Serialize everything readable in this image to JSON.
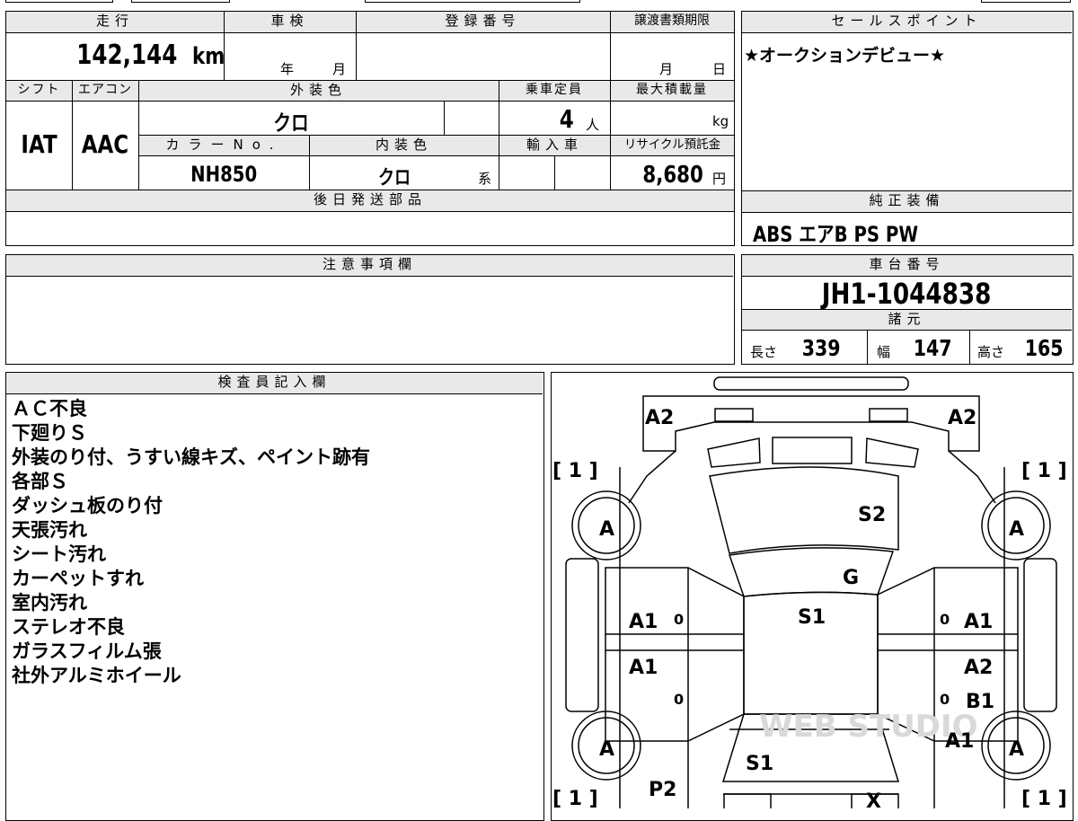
{
  "top_left": {
    "headers": {
      "mileage": "走行",
      "inspection": "車検",
      "registration": "登録番号",
      "transfer": "譲渡書類期限",
      "shift": "シフト",
      "aircon": "エアコン",
      "exterior_color": "外装色",
      "capacity": "乗車定員",
      "max_load": "最大積載量",
      "color_no": "カラーNo.",
      "interior_color": "内装色",
      "import": "輸入車",
      "recycle": "リサイクル預託金",
      "later_parts": "後日発送部品",
      "notes": "注意事項欄"
    },
    "mileage_value": "142,144",
    "mileage_unit": "km",
    "year_unit": "年",
    "month_unit": "月",
    "transfer_month": "月",
    "transfer_day": "日",
    "shift_value": "IAT",
    "aircon_value": "AAC",
    "exterior_color_value": "クロ",
    "capacity_value": "4",
    "capacity_unit": "人",
    "load_unit": "kg",
    "color_no_value": "NH850",
    "interior_color_value": "クロ",
    "interior_suffix": "系",
    "recycle_value": "8,680",
    "recycle_unit": "円"
  },
  "right_panel": {
    "sales_point_header": "セールスポイント",
    "sales_point_text": "★オークションデビュー★",
    "equipment_header": "純正装備",
    "equipment_value": "ABS エアB PS PW",
    "chassis_header": "車台番号",
    "chassis_value": "JH1-1044838",
    "specs_header": "諸元",
    "length_label": "長さ",
    "length_value": "339",
    "width_label": "幅",
    "width_value": "147",
    "height_label": "高さ",
    "height_value": "165"
  },
  "inspector": {
    "header": "検査員記入欄",
    "lines": [
      "ＡＣ不良",
      "下廻りＳ",
      "外装のり付、うすい線キズ、ペイント跡有",
      "各部Ｓ",
      "ダッシュ板のり付",
      "天張汚れ",
      "シート汚れ",
      "カーペットすれ",
      "室内汚れ",
      "ステレオ不良",
      "ガラスフィルム張",
      "社外アルミホイール"
    ]
  },
  "diagram": {
    "marks": {
      "a2_left": "A2",
      "a2_right": "A2",
      "bracket_tl": "[ 1 ]",
      "bracket_tr": "[ 1 ]",
      "bracket_bl": "[ 1 ]",
      "bracket_br": "[ 1 ]",
      "wheel_fl": "A",
      "wheel_fr": "A",
      "wheel_rl": "A",
      "wheel_rr": "A",
      "hood": "S2",
      "windshield": "G",
      "roof": "S1",
      "door_fl": "A1",
      "door_fl_zero": "0",
      "door_rl": "A1",
      "door_rl_zero": "0",
      "door_fr_zero": "0",
      "door_fr": "A1",
      "door_rr": "A2",
      "door_rr_zero": "0",
      "door_rr_b": "B1",
      "quarter_r": "A1",
      "trunk": "S1",
      "quarter_l": "P2",
      "rear_x": "X"
    },
    "watermark": "WEB STUDIO"
  }
}
